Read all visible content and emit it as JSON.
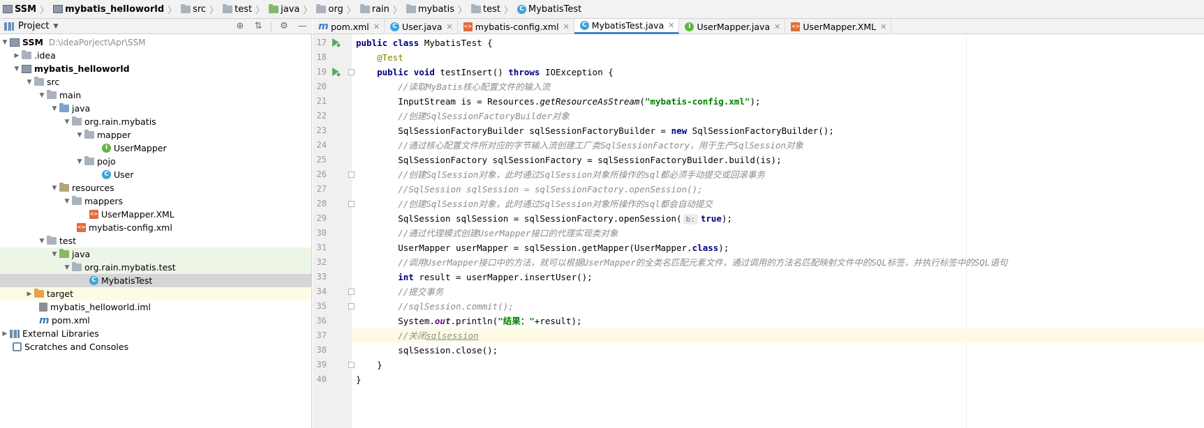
{
  "breadcrumb": [
    {
      "label": "SSM",
      "icon": "module-icon"
    },
    {
      "label": "mybatis_helloworld",
      "icon": "module-icon"
    },
    {
      "label": "src",
      "icon": "folder-icon"
    },
    {
      "label": "test",
      "icon": "folder-icon"
    },
    {
      "label": "java",
      "icon": "test-folder-icon"
    },
    {
      "label": "org",
      "icon": "folder-icon"
    },
    {
      "label": "rain",
      "icon": "folder-icon"
    },
    {
      "label": "mybatis",
      "icon": "folder-icon"
    },
    {
      "label": "test",
      "icon": "folder-icon"
    },
    {
      "label": "MybatisTest",
      "icon": "class-icon"
    }
  ],
  "project_panel": {
    "title": "Project"
  },
  "tree": [
    {
      "label": "SSM",
      "meta": "D:\\ideaPorject\\Apr\\SSM"
    },
    {
      "label": ".idea"
    },
    {
      "label": "mybatis_helloworld"
    },
    {
      "label": "src"
    },
    {
      "label": "main"
    },
    {
      "label": "java"
    },
    {
      "label": "org.rain.mybatis"
    },
    {
      "label": "mapper"
    },
    {
      "label": "UserMapper"
    },
    {
      "label": "pojo"
    },
    {
      "label": "User"
    },
    {
      "label": "resources"
    },
    {
      "label": "mappers"
    },
    {
      "label": "UserMapper.XML"
    },
    {
      "label": "mybatis-config.xml"
    },
    {
      "label": "test"
    },
    {
      "label": "java"
    },
    {
      "label": "org.rain.mybatis.test"
    },
    {
      "label": "MybatisTest"
    },
    {
      "label": "target"
    },
    {
      "label": "mybatis_helloworld.iml"
    },
    {
      "label": "pom.xml"
    },
    {
      "label": "External Libraries"
    },
    {
      "label": "Scratches and Consoles"
    }
  ],
  "tabs": [
    {
      "label": "pom.xml"
    },
    {
      "label": "User.java"
    },
    {
      "label": "mybatis-config.xml"
    },
    {
      "label": "MybatisTest.java"
    },
    {
      "label": "UserMapper.java"
    },
    {
      "label": "UserMapper.XML"
    }
  ],
  "line_numbers": [
    "17",
    "18",
    "19",
    "20",
    "21",
    "22",
    "23",
    "24",
    "25",
    "26",
    "27",
    "28",
    "29",
    "30",
    "31",
    "32",
    "33",
    "34",
    "35",
    "36",
    "37",
    "38",
    "39",
    "40"
  ],
  "code": {
    "l17": {
      "kw1": "public",
      "kw2": "class",
      "rest": " MybatisTest {"
    },
    "l18": {
      "annotation": "@Test"
    },
    "l19": {
      "kw1": "public",
      "kw2": "void",
      "mid": " testInsert() ",
      "kw3": "throws",
      "rest": " IOException {"
    },
    "l20": {
      "comment": "//读取MyBatis核心配置文件的输入流"
    },
    "l21": {
      "pre": "InputStream is = Resources.",
      "method": "getResourceAsStream",
      "open": "(",
      "str": "\"mybatis-config.xml\"",
      "rest": ");"
    },
    "l22": {
      "comment": "//创建SqlSessionFactoryBuilder对象"
    },
    "l23": {
      "pre": "SqlSessionFactoryBuilder sqlSessionFactoryBuilder = ",
      "kw": "new",
      "rest": " SqlSessionFactoryBuilder();"
    },
    "l24": {
      "comment": "//通过核心配置文件所对应的字节输入流创建工厂类SqlSessionFactory，用于生产SqlSession对象"
    },
    "l25": {
      "text": "SqlSessionFactory sqlSessionFactory = sqlSessionFactoryBuilder.build(is);"
    },
    "l26": {
      "comment": "//创建SqlSession对象，此时通过SqlSession对象所操作的sql都必须手动提交或回滚事务"
    },
    "l27": {
      "comment": "//SqlSession sqlSession = sqlSessionFactory.openSession();"
    },
    "l28": {
      "comment": "//创建SqlSession对象，此时通过SqlSession对象所操作的sql都会自动提交"
    },
    "l29": {
      "pre": "SqlSession sqlSession = sqlSessionFactory.openSession(",
      "hint": "b:",
      "kw": "true",
      "rest": ");"
    },
    "l30": {
      "comment": "//通过代理模式创建UserMapper接口的代理实现类对象"
    },
    "l31": {
      "pre": "UserMapper userMapper = sqlSession.getMapper(UserMapper.",
      "kw": "class",
      "rest": ");"
    },
    "l32": {
      "comment": "//调用UserMapper接口中的方法，就可以根据UserMapper的全类名匹配元素文件，通过调用的方法名匹配映射文件中的SQL标签，并执行标签中的SQL语句"
    },
    "l33": {
      "kw": "int",
      "rest": " result = userMapper.insertUser();"
    },
    "l34": {
      "comment": "//提交事务"
    },
    "l35": {
      "comment": "//sqlSession.commit();"
    },
    "l36": {
      "pre": "System.",
      "field": "out",
      "mid": ".println(",
      "str": "\"结果：\"",
      "rest": "+result);"
    },
    "l37": {
      "comment_pre": "//关闭",
      "comment_ul": "sqlsession"
    },
    "l38": {
      "text": "sqlSession.close();"
    },
    "l39": {
      "text": "}"
    },
    "l40": {
      "text": "}"
    }
  }
}
